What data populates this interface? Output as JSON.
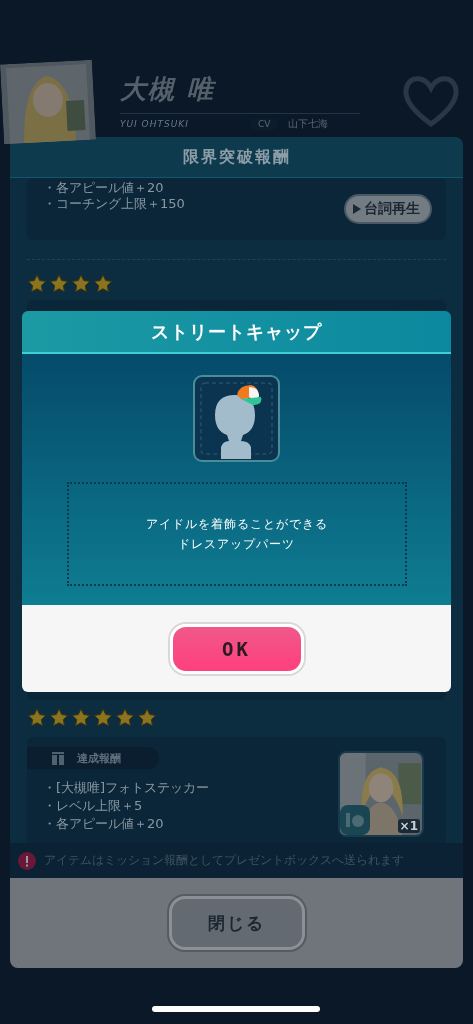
{
  "profile": {
    "name": "大槻 唯",
    "romaji": "YUI OHTSUKI",
    "cv_label": "CV",
    "cv_name": "山下七海"
  },
  "panel": {
    "title": "限界突破報酬",
    "prev_card": {
      "lines": [
        "・各アピール値＋20",
        "・コーチング上限＋150"
      ],
      "voice_button": "台詞再生"
    },
    "sections": [
      {
        "stars": 4
      },
      {
        "stars": 6,
        "badge": "達成報酬",
        "lines": [
          "・[大槻唯]フォトステッカー",
          "・レベル上限＋5",
          "・各アピール値＋20"
        ],
        "quantity": "×1"
      }
    ],
    "notice": "アイテムはミッション報酬としてプレゼントボックスへ送られます",
    "close_button": "閉じる"
  },
  "dialog": {
    "title": "ストリートキャップ",
    "description": [
      "アイドルを着飾ることができる",
      "ドレスアップパーツ"
    ],
    "ok_button": "OK"
  }
}
